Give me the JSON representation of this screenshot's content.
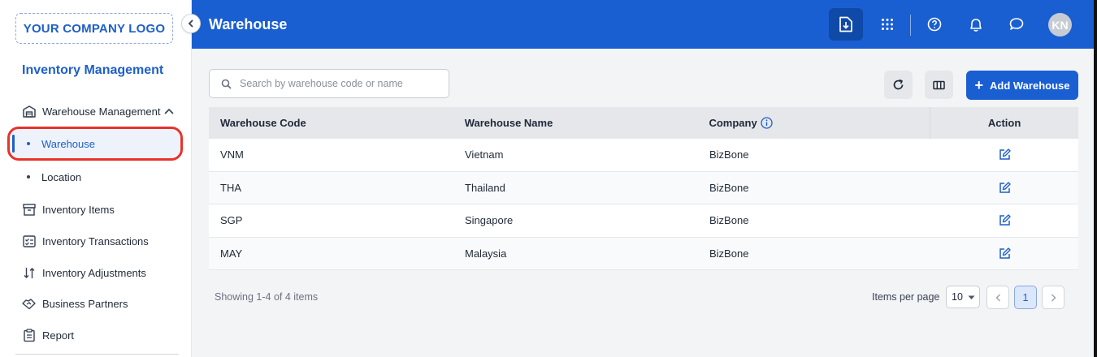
{
  "sidebar": {
    "logo_text": "YOUR COMPANY LOGO",
    "app_title": "Inventory Management",
    "group": {
      "label": "Warehouse Management",
      "icon": "warehouse-icon",
      "expanded": true
    },
    "sub_items": [
      {
        "label": "Warehouse",
        "active": true
      },
      {
        "label": "Location",
        "active": false
      }
    ],
    "items": [
      {
        "label": "Inventory Items",
        "icon": "archive-box-icon"
      },
      {
        "label": "Inventory Transactions",
        "icon": "checklist-icon"
      },
      {
        "label": "Inventory Adjustments",
        "icon": "sort-arrows-icon"
      },
      {
        "label": "Business Partners",
        "icon": "handshake-icon"
      },
      {
        "label": "Report",
        "icon": "clipboard-icon"
      }
    ]
  },
  "header": {
    "title": "Warehouse",
    "avatar_initials": "KN",
    "brand_color": "#1a5fd1"
  },
  "toolbar": {
    "search_placeholder": "Search by warehouse code or name",
    "add_label": "Add Warehouse"
  },
  "table": {
    "columns": [
      "Warehouse Code",
      "Warehouse Name",
      "Company",
      "Action"
    ],
    "rows": [
      {
        "code": "VNM",
        "name": "Vietnam",
        "company": "BizBone"
      },
      {
        "code": "THA",
        "name": "Thailand",
        "company": "BizBone"
      },
      {
        "code": "SGP",
        "name": "Singapore",
        "company": "BizBone"
      },
      {
        "code": "MAY",
        "name": "Malaysia",
        "company": "BizBone"
      }
    ]
  },
  "pagination": {
    "summary": "Showing 1-4 of 4 items",
    "items_per_page_label": "Items per page",
    "items_per_page": "10",
    "current_page": "1"
  }
}
